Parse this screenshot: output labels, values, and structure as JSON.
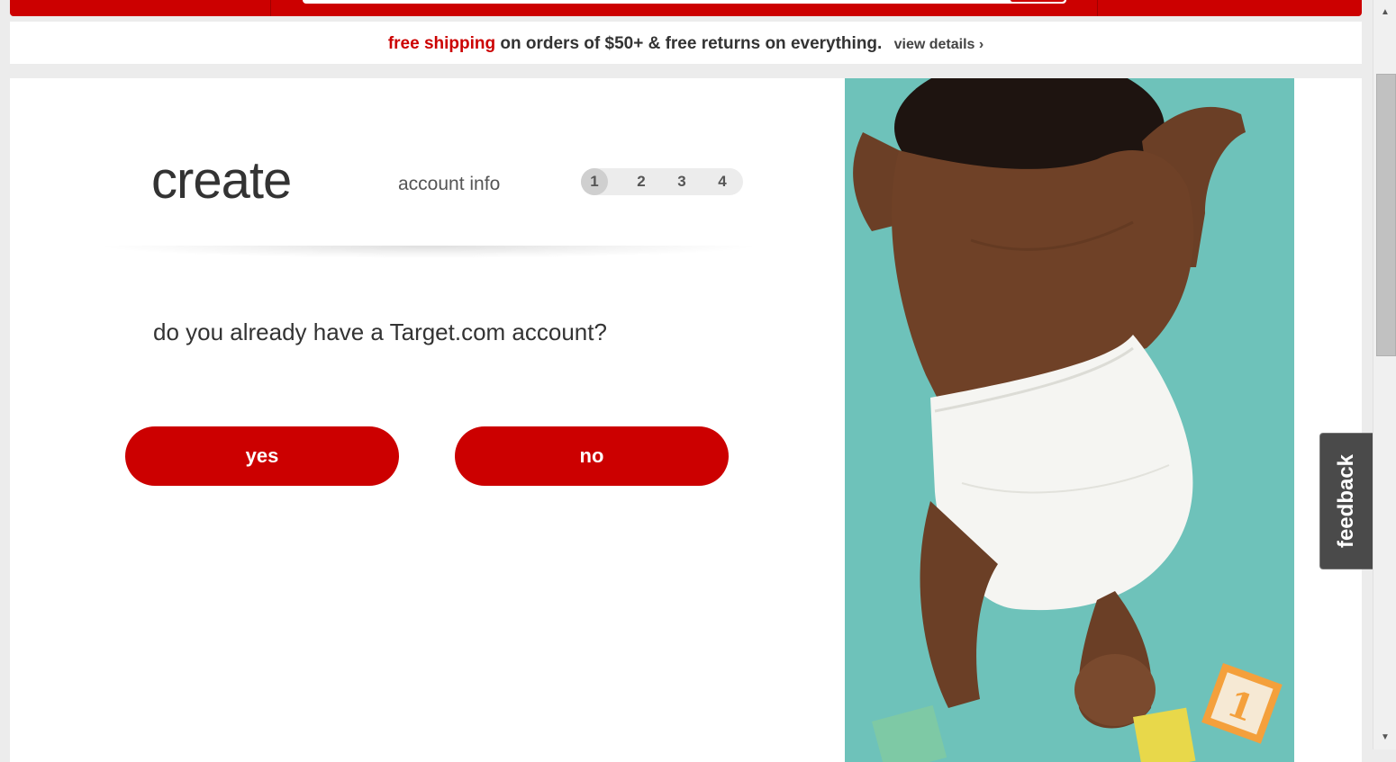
{
  "promo": {
    "highlight": "free shipping",
    "text": " on orders of $50+ & free returns on everything.",
    "details_link": "view details ›"
  },
  "signup": {
    "title": "create",
    "step_label": "account info",
    "steps": [
      "1",
      "2",
      "3",
      "4"
    ],
    "active_step": 1,
    "question": "do you already have a Target.com account?",
    "yes_label": "yes",
    "no_label": "no"
  },
  "feedback": {
    "label": "feedback"
  },
  "colors": {
    "brand_red": "#cc0000",
    "feedback_bg": "#4a4a4a",
    "hero_teal": "#6ec2ba"
  },
  "scrollbar": {
    "up_icon": "▲",
    "down_icon": "▼"
  }
}
